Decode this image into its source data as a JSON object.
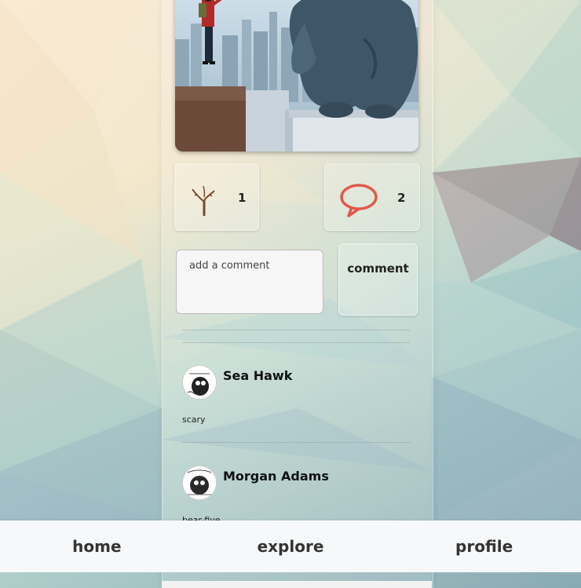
{
  "post": {
    "likes_count": "1",
    "comments_count": "2"
  },
  "comment_form": {
    "placeholder": "add a comment",
    "button_label": "comment"
  },
  "comments": [
    {
      "author": "Sea Hawk",
      "text": "scary"
    },
    {
      "author": "Morgan Adams",
      "text": "bear-five"
    }
  ],
  "nav": {
    "home": "home",
    "explore": "explore",
    "profile": "profile"
  },
  "colors": {
    "comment_icon": "#e05a4c",
    "nav_bg": "#f7f8f9"
  },
  "icons": {
    "like": "sapling-icon",
    "comment": "speech-bubble-icon"
  }
}
